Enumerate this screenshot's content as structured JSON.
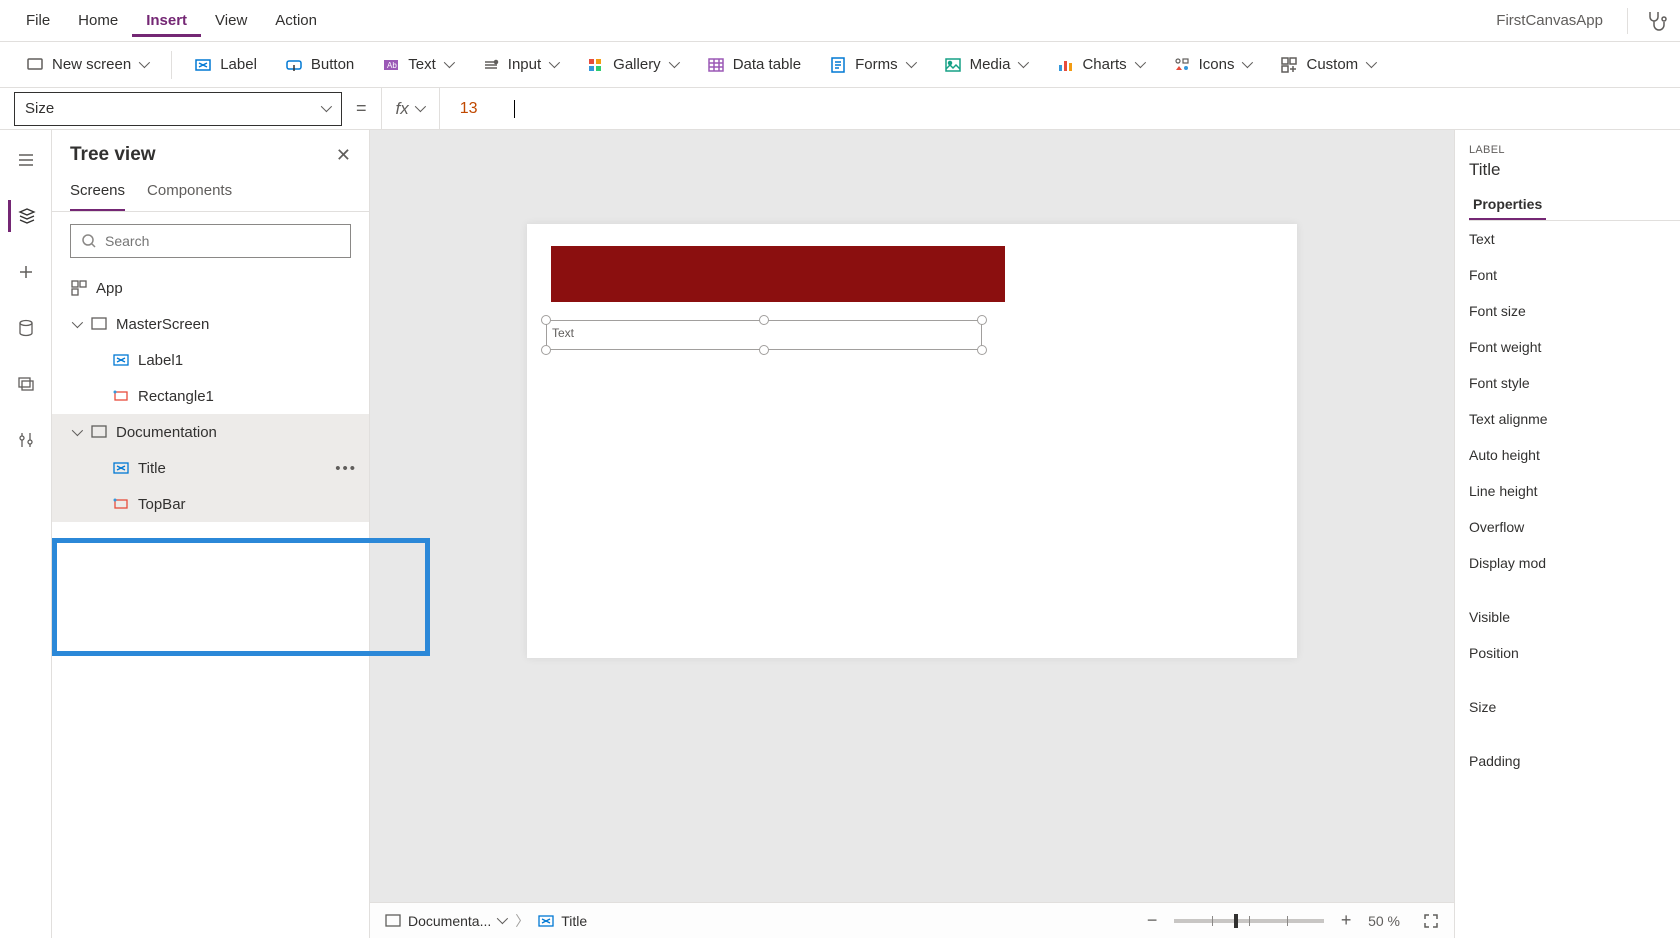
{
  "app_name": "FirstCanvasApp",
  "menu": {
    "file": "File",
    "home": "Home",
    "insert": "Insert",
    "view": "View",
    "action": "Action"
  },
  "toolbar": {
    "new_screen": "New screen",
    "label": "Label",
    "button": "Button",
    "text": "Text",
    "input": "Input",
    "gallery": "Gallery",
    "data_table": "Data table",
    "forms": "Forms",
    "media": "Media",
    "charts": "Charts",
    "icons": "Icons",
    "custom": "Custom"
  },
  "formula": {
    "property": "Size",
    "value": "13"
  },
  "tree": {
    "title": "Tree view",
    "tabs": {
      "screens": "Screens",
      "components": "Components"
    },
    "search_placeholder": "Search",
    "app": "App",
    "items": [
      {
        "label": "MasterScreen",
        "children": [
          "Label1",
          "Rectangle1"
        ]
      },
      {
        "label": "Documentation",
        "children": [
          "Title",
          "TopBar"
        ]
      }
    ]
  },
  "canvas_label_text": "Text",
  "props": {
    "header": "LABEL",
    "title": "Title",
    "tab": "Properties",
    "rows": [
      "Text",
      "Font",
      "Font size",
      "Font weight",
      "Font style",
      "Text alignme",
      "Auto height",
      "Line height",
      "Overflow",
      "Display mod",
      "Visible",
      "Position",
      "Size",
      "Padding"
    ]
  },
  "status": {
    "bc_screen": "Documenta...",
    "bc_control": "Title",
    "zoom_value": "50",
    "zoom_unit": "%"
  },
  "colors": {
    "topbar": "#8b0f0f",
    "accent": "#742774",
    "highlight": "#2b88d8"
  }
}
